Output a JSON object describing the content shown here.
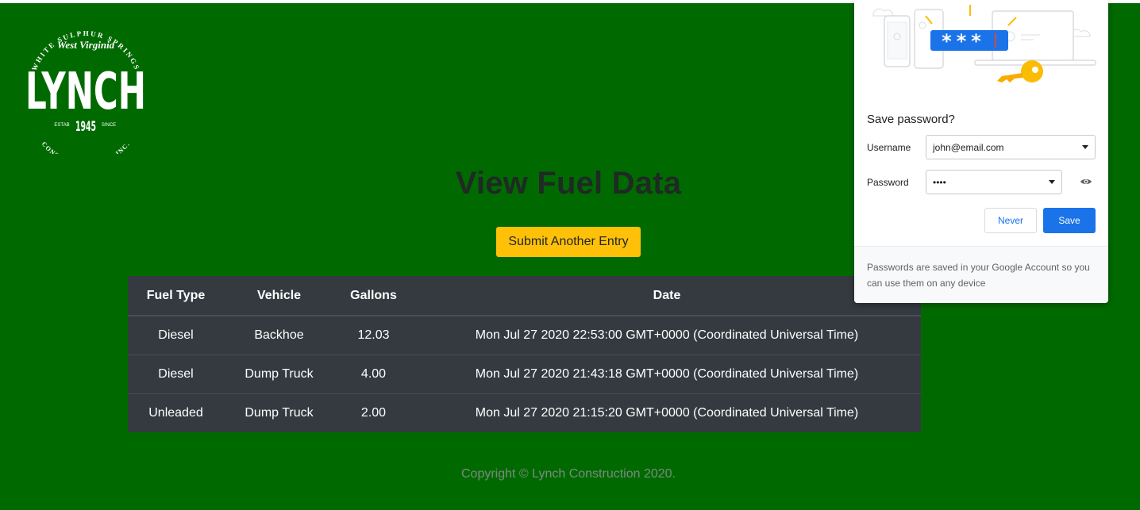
{
  "logo": {
    "arc_top": "WHITE SULPHUR SPRINGS",
    "script": "West Virginia",
    "name": "LYNCH",
    "estab": "ESTAB",
    "year": "1945",
    "since": "SINCE",
    "arc_bottom": "CONSTRUCTION CO., INC."
  },
  "page": {
    "title": "View Fuel Data",
    "submit_button": "Submit Another Entry",
    "footer": "Copyright © Lynch Construction 2020."
  },
  "table": {
    "headers": [
      "Fuel Type",
      "Vehicle",
      "Gallons",
      "Date"
    ],
    "rows": [
      [
        "Diesel",
        "Backhoe",
        "12.03",
        "Mon Jul 27 2020 22:53:00 GMT+0000 (Coordinated Universal Time)"
      ],
      [
        "Diesel",
        "Dump Truck",
        "4.00",
        "Mon Jul 27 2020 21:43:18 GMT+0000 (Coordinated Universal Time)"
      ],
      [
        "Unleaded",
        "Dump Truck",
        "2.00",
        "Mon Jul 27 2020 21:15:20 GMT+0000 (Coordinated Universal Time)"
      ]
    ]
  },
  "password_popup": {
    "title": "Save password?",
    "username_label": "Username",
    "username_value": "john@email.com",
    "password_label": "Password",
    "password_value": "••••",
    "never_button": "Never",
    "save_button": "Save",
    "footer_text": "Passwords are saved in your Google Account so you can use them on any device",
    "illustration_mask": "***"
  },
  "colors": {
    "page_background": "#006a00",
    "table_background": "#343a40",
    "submit_button": "#ffc107",
    "save_button": "#1a73e8"
  }
}
